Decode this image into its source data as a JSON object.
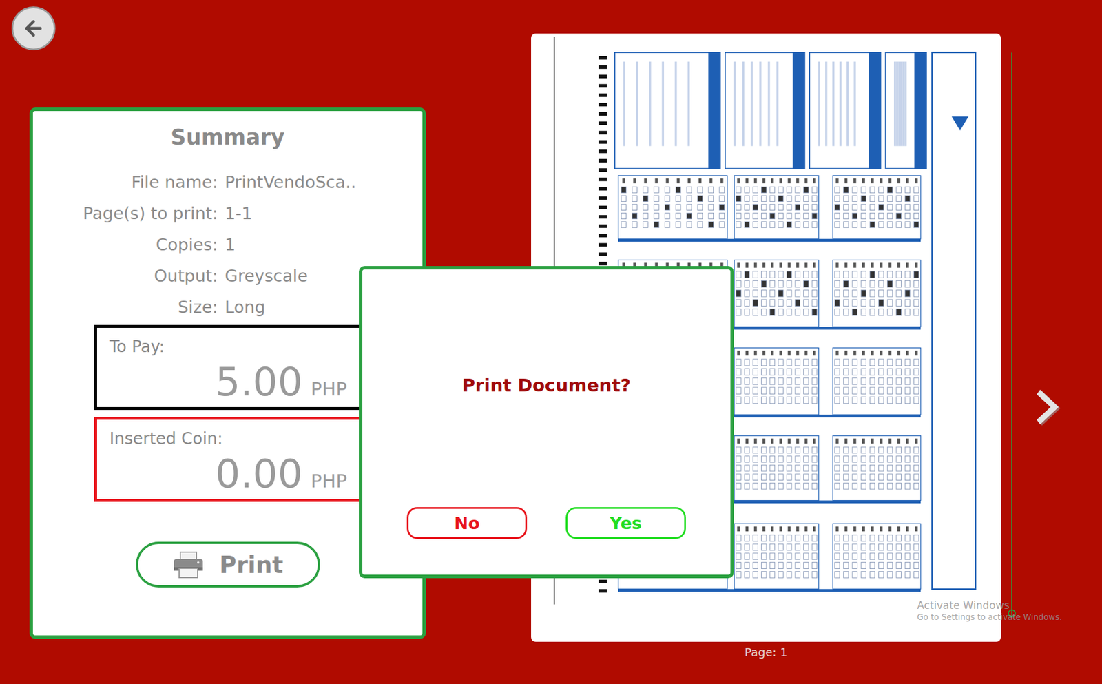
{
  "summary": {
    "title": "Summary",
    "rows": [
      {
        "label": "File name:",
        "value": "PrintVendoSca.."
      },
      {
        "label": "Page(s) to print:",
        "value": "1-1"
      },
      {
        "label": "Copies:",
        "value": "1"
      },
      {
        "label": "Output:",
        "value": "Greyscale"
      },
      {
        "label": "Size:",
        "value": "Long"
      }
    ]
  },
  "amounts": [
    {
      "label": "To Pay:",
      "amount": "5.00",
      "currency": "PHP",
      "color": "#000000"
    },
    {
      "label": "Inserted Coin:",
      "amount": "0.00",
      "currency": "PHP",
      "color": "#e8141b"
    }
  ],
  "print_button": {
    "label": "Print"
  },
  "preview": {
    "page_label": "Page: 1",
    "scroll": {
      "level": 1
    }
  },
  "dialog": {
    "title": "Print Document?",
    "buttons": [
      {
        "label": "No",
        "color": "#e8141b"
      },
      {
        "label": "Yes",
        "color": "#22dd22"
      }
    ]
  },
  "watermark": {
    "title": "Activate Windows",
    "subtitle": "Go to Settings to activate Windows."
  }
}
